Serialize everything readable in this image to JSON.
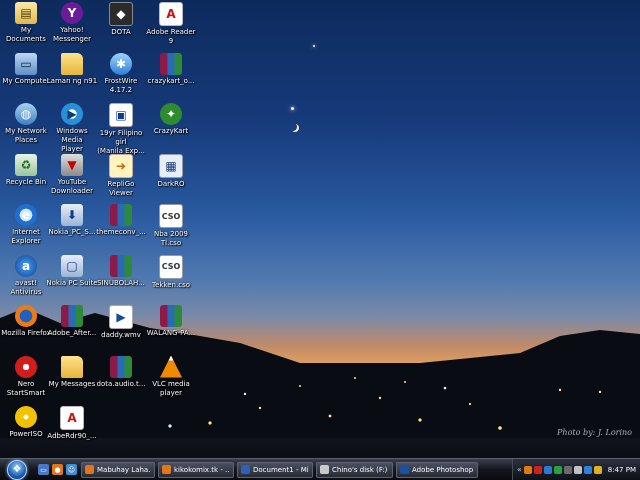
{
  "desktop": {
    "icons": [
      {
        "label": "My Documents",
        "glyph": "docs-icon",
        "symbol": "▤"
      },
      {
        "label": "Yahoo!\nMessenger",
        "glyph": "yahoo-icon",
        "symbol": "Y"
      },
      {
        "label": "DOTA",
        "glyph": "dota-icon",
        "symbol": "◆"
      },
      {
        "label": "Adobe Reader\n9",
        "glyph": "pdf-icon",
        "symbol": "A"
      },
      {
        "label": "My Computer",
        "glyph": "computer-icon",
        "symbol": "▭"
      },
      {
        "label": "Laman ng n91",
        "glyph": "folder-icon",
        "symbol": ""
      },
      {
        "label": "FrostWire\n4.17.2",
        "glyph": "frostwire-icon",
        "symbol": "✱"
      },
      {
        "label": "crazykart_o...",
        "glyph": "winrar-icon",
        "symbol": ""
      },
      {
        "label": "My Network\nPlaces",
        "glyph": "network-icon",
        "symbol": "◍"
      },
      {
        "label": "Windows Media\nPlayer",
        "glyph": "media-player-icon",
        "symbol": "▶"
      },
      {
        "label": "19yr Filipino girl\n(Manila Exp...",
        "glyph": "video-file-icon",
        "symbol": "▣"
      },
      {
        "label": "CrazyKart",
        "glyph": "kart-icon",
        "symbol": "✦"
      },
      {
        "label": "Recycle Bin",
        "glyph": "recycle-bin-icon",
        "symbol": "♻"
      },
      {
        "label": "YouTube\nDownloader",
        "glyph": "youtube-downloader-icon",
        "symbol": "▼"
      },
      {
        "label": "RepliGo Viewer",
        "glyph": "repligo-icon",
        "symbol": "➜"
      },
      {
        "label": "DarkRO",
        "glyph": "darkro-icon",
        "symbol": "▦"
      },
      {
        "label": "Internet\nExplorer",
        "glyph": "internet-explorer-icon",
        "symbol": "e"
      },
      {
        "label": "Nokia_PC_S...",
        "glyph": "nokia-installer-icon",
        "symbol": "⬇"
      },
      {
        "label": "themeconv_...",
        "glyph": "winrar-icon",
        "symbol": ""
      },
      {
        "label": "Nba 2009\nTl.cso",
        "glyph": "iso-file-icon",
        "symbol": "CSO"
      },
      {
        "label": "avast!\nAntivirus",
        "glyph": "avast-icon",
        "symbol": "a"
      },
      {
        "label": "Nokia PC Suite",
        "glyph": "nokia-suite-icon",
        "symbol": "▢"
      },
      {
        "label": "SINUBOLAH...",
        "glyph": "winrar-icon",
        "symbol": ""
      },
      {
        "label": "Tekken.cso",
        "glyph": "iso-file-icon",
        "symbol": "CSO"
      },
      {
        "label": "Mozilla Firefox",
        "glyph": "firefox-icon",
        "symbol": ""
      },
      {
        "label": "Adobe_After...",
        "glyph": "winrar-icon",
        "symbol": ""
      },
      {
        "label": "daddy.wmv",
        "glyph": "wmv-file-icon",
        "symbol": "▶"
      },
      {
        "label": "WALANG-PA...",
        "glyph": "winrar-icon",
        "symbol": ""
      },
      {
        "label": "Nero\nStartSmart",
        "glyph": "nero-icon",
        "symbol": ""
      },
      {
        "label": "My Messages",
        "glyph": "folder-icon",
        "symbol": ""
      },
      {
        "label": "dota.audio.t...",
        "glyph": "winrar-icon",
        "symbol": ""
      },
      {
        "label": "VLC media\nplayer",
        "glyph": "vlc-icon",
        "symbol": ""
      },
      {
        "label": "PowerISO",
        "glyph": "poweriso-icon",
        "symbol": ""
      },
      {
        "label": "AdbeRdr90_...",
        "glyph": "pdf-icon",
        "symbol": "A"
      }
    ],
    "signature": "Photo by: J. Lorino"
  },
  "taskbar": {
    "start_symbol": "❖",
    "quick_launch": [
      {
        "name": "show-desktop-icon",
        "symbol": "▭",
        "color": "#4a78c8"
      },
      {
        "name": "firefox-icon",
        "symbol": "●",
        "color": "#e2761b"
      },
      {
        "name": "messenger-icon",
        "symbol": "☺",
        "color": "#3a8fd8"
      }
    ],
    "tasks": [
      {
        "label": "Mabuhay Laha...",
        "icon_color": "#e2761b"
      },
      {
        "label": "kikokomix.tk - ...",
        "icon_color": "#e2761b"
      },
      {
        "label": "Document1 - Mi...",
        "icon_color": "#2b5fb8"
      },
      {
        "label": "Chino's disk (F:)",
        "icon_color": "#c9c9c9"
      },
      {
        "label": "Adobe Photoshop",
        "icon_color": "#1d4fa0"
      }
    ],
    "tray_expand": "«",
    "tray_icons": [
      "#e07a10",
      "#d02020",
      "#2a7ad0",
      "#2aa040",
      "#6a6a6a",
      "#c0c0c0",
      "#3080e0",
      "#e0b020"
    ],
    "clock": "8:47 PM"
  },
  "colors": {
    "taskbar": "#14161c",
    "label_text": "#ffffff"
  }
}
